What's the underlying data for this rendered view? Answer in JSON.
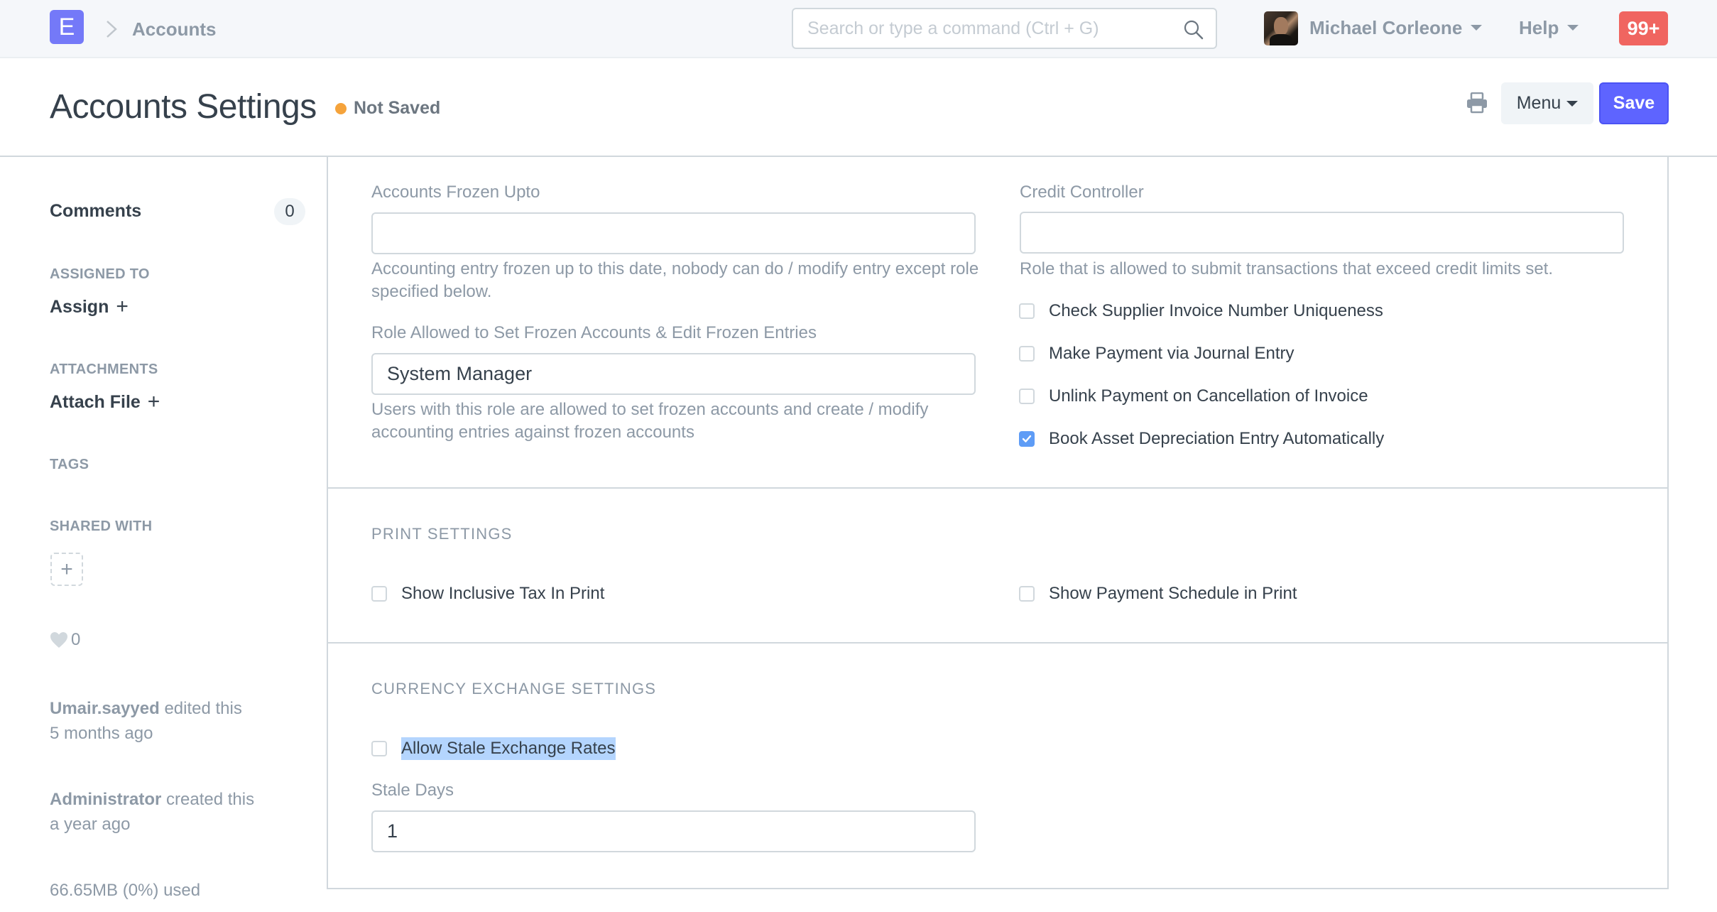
{
  "navbar": {
    "logo_letter": "E",
    "breadcrumb": "Accounts",
    "search_placeholder": "Search or type a command (Ctrl + G)",
    "search_value": "",
    "user_name": "Michael Corleone",
    "help_label": "Help",
    "notification_count": "99+"
  },
  "page": {
    "title": "Accounts Settings",
    "status": "Not Saved",
    "status_color": "#f5a33b",
    "menu_label": "Menu",
    "save_label": "Save"
  },
  "sidebar": {
    "comments_label": "Comments",
    "comments_count": "0",
    "assigned_to_heading": "ASSIGNED TO",
    "assign_label": "Assign",
    "attachments_heading": "ATTACHMENTS",
    "attach_label": "Attach File",
    "tags_heading": "TAGS",
    "shared_with_heading": "SHARED WITH",
    "likes_count": "0",
    "activity": [
      {
        "user": "Umair.sayyed",
        "action": "edited this",
        "time": "5 months ago"
      },
      {
        "user": "Administrator",
        "action": "created this",
        "time": "a year ago"
      }
    ],
    "storage_usage": "66.65MB (0%) used"
  },
  "form": {
    "accounts_frozen_upto": {
      "label": "Accounts Frozen Upto",
      "value": "",
      "help": "Accounting entry frozen up to this date, nobody can do / modify entry except role specified below."
    },
    "frozen_role": {
      "label": "Role Allowed to Set Frozen Accounts & Edit Frozen Entries",
      "value": "System Manager",
      "help": "Users with this role are allowed to set frozen accounts and create / modify accounting entries against frozen accounts"
    },
    "credit_controller": {
      "label": "Credit Controller",
      "value": "",
      "help": "Role that is allowed to submit transactions that exceed credit limits set."
    },
    "checkboxes": [
      {
        "label": "Check Supplier Invoice Number Uniqueness",
        "checked": false
      },
      {
        "label": "Make Payment via Journal Entry",
        "checked": false
      },
      {
        "label": "Unlink Payment on Cancellation of Invoice",
        "checked": false
      },
      {
        "label": "Book Asset Depreciation Entry Automatically",
        "checked": true
      }
    ],
    "print_settings": {
      "title": "PRINT SETTINGS",
      "show_inclusive_tax": {
        "label": "Show Inclusive Tax In Print",
        "checked": false
      },
      "show_payment_schedule": {
        "label": "Show Payment Schedule in Print",
        "checked": false
      }
    },
    "currency_exchange": {
      "title": "CURRENCY EXCHANGE SETTINGS",
      "allow_stale": {
        "label": "Allow Stale Exchange Rates",
        "checked": false,
        "text_selected": true
      },
      "stale_days": {
        "label": "Stale Days",
        "value": "1"
      }
    }
  }
}
